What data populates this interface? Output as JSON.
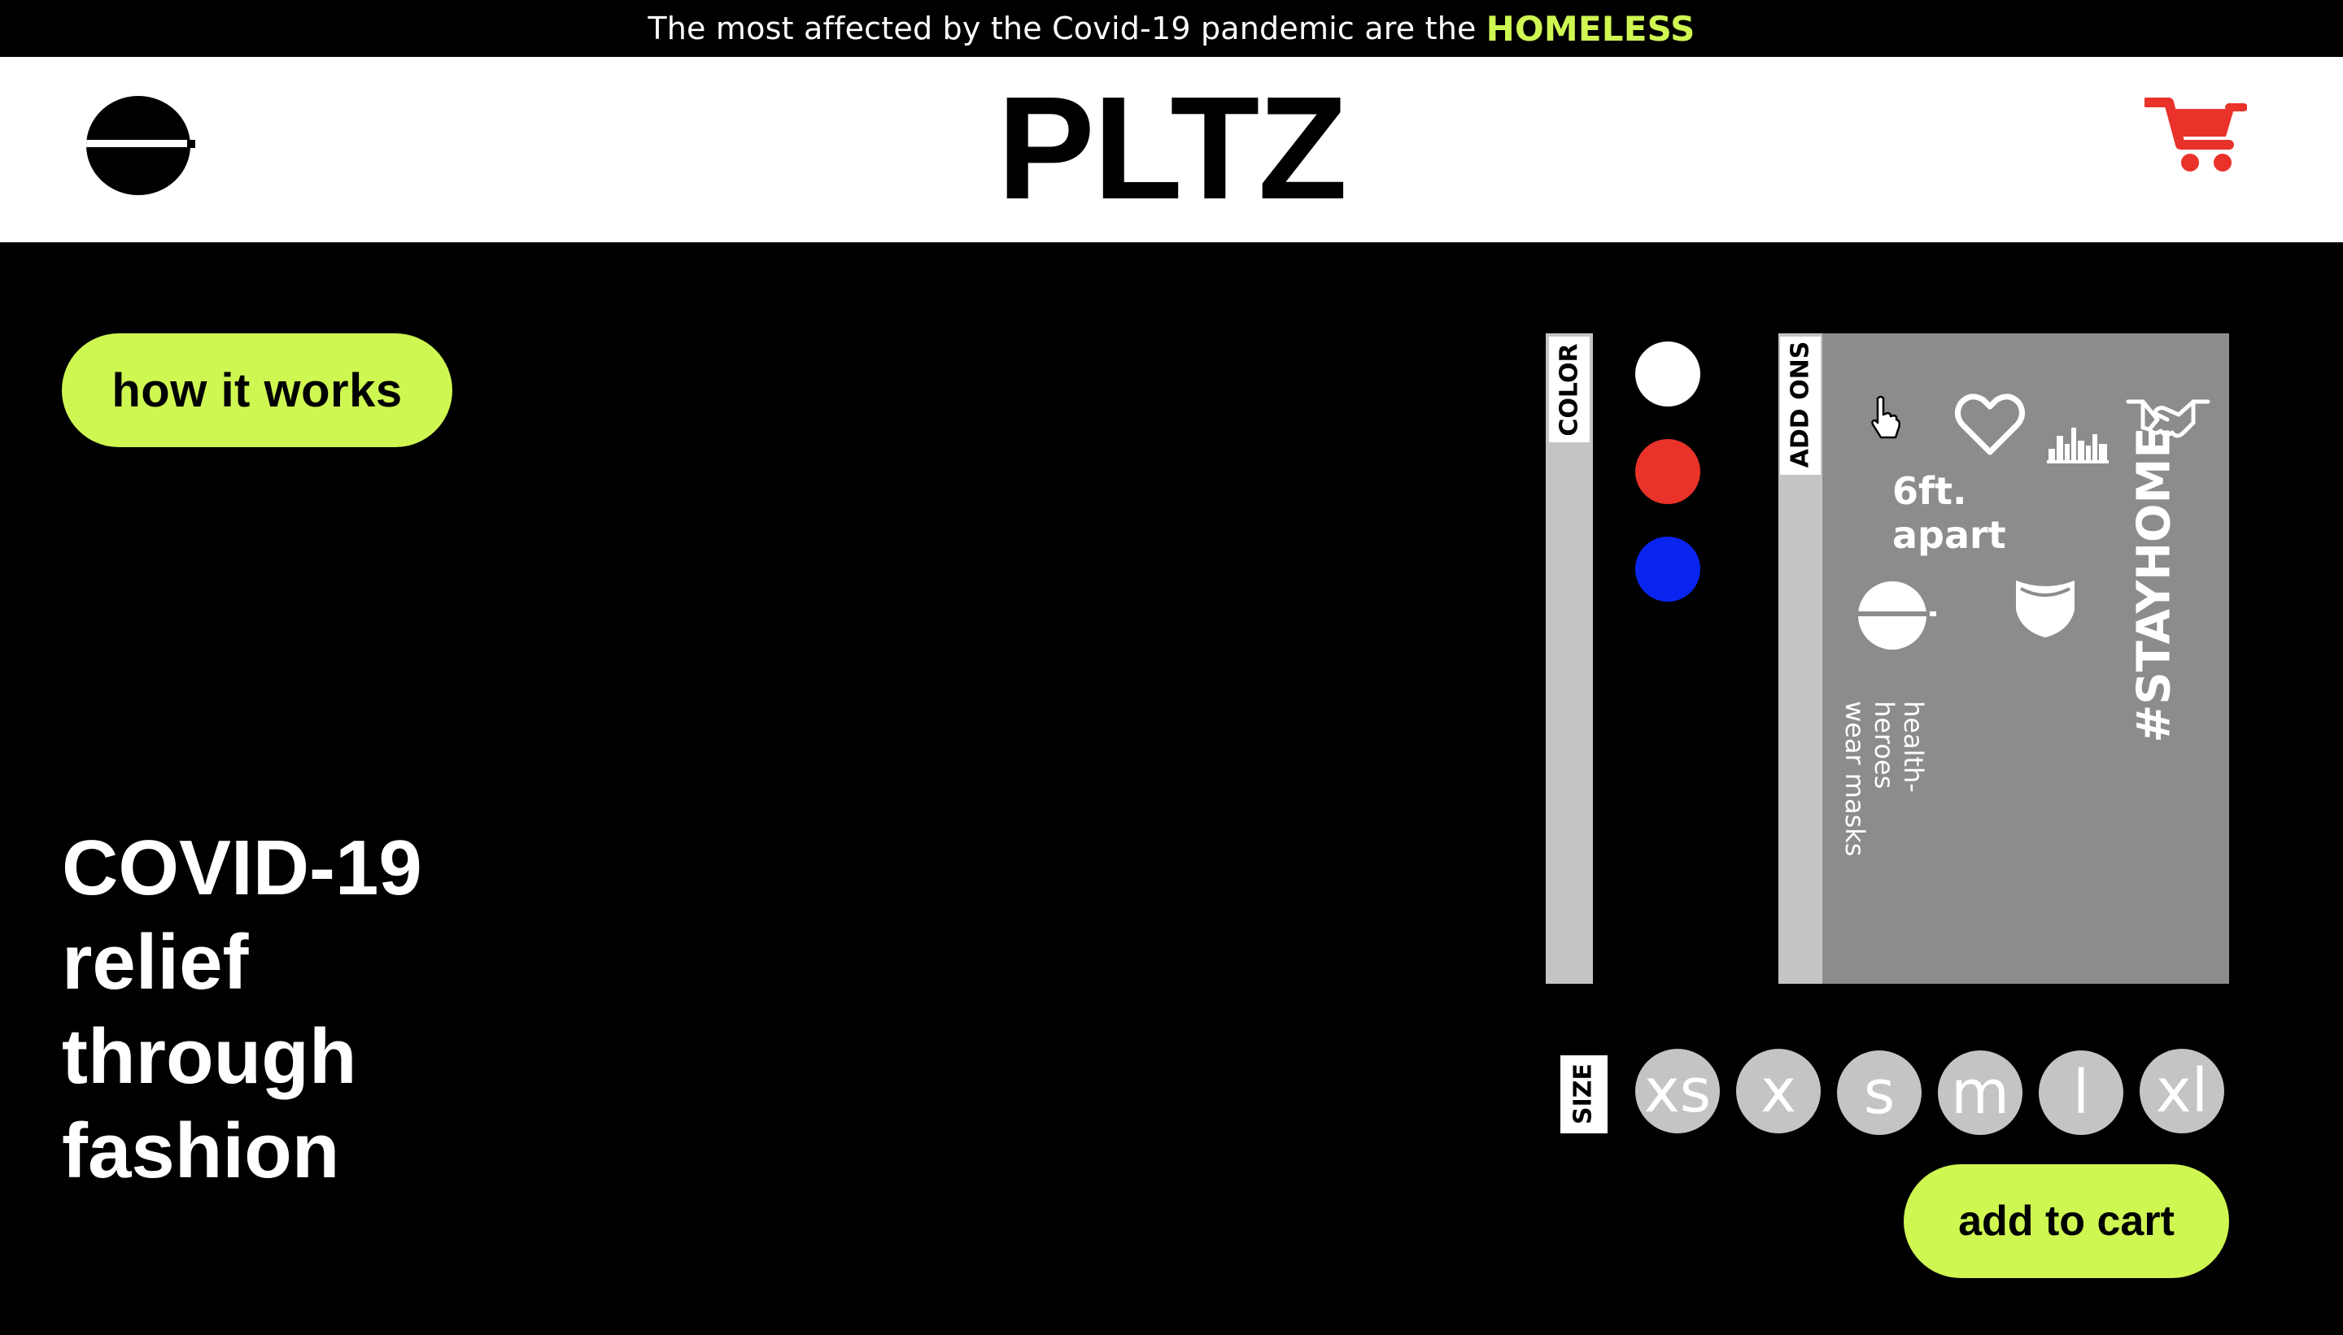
{
  "announcement": {
    "text": "The most affected by the Covid-19 pandemic are the",
    "highlight": "HOMELESS"
  },
  "header": {
    "brand": "PLTZ",
    "logo_icon": "pltz-logo-icon",
    "cart_icon": "shopping-cart-icon"
  },
  "hero": {
    "how_it_works_label": "how it works",
    "tagline": [
      "COVID-19",
      "relief",
      "through",
      "fashion"
    ]
  },
  "color": {
    "label": "COLOR",
    "options": [
      "#ffffff",
      "#e8322a",
      "#0a24f0"
    ]
  },
  "addons": {
    "label": "ADD ONS",
    "icons": [
      "pointer-hand-icon",
      "heart-icon",
      "city-skyline-icon",
      "handshake-icon",
      "pltz-logo-icon",
      "face-mask-icon"
    ],
    "six_ft": "6ft. apart",
    "stayhome": "#STAYHOME",
    "heroes_line1": "health-heroes",
    "heroes_line2": "wear masks"
  },
  "size": {
    "label": "SIZE",
    "options": [
      "xs",
      "x",
      "s",
      "m",
      "l",
      "xl"
    ]
  },
  "cart": {
    "add_label": "add to cart"
  },
  "colors": {
    "accent": "#cef752",
    "cart_red": "#e8322a",
    "panel_gray": "#8c8c8c",
    "strip_gray": "#c4c4c4"
  }
}
